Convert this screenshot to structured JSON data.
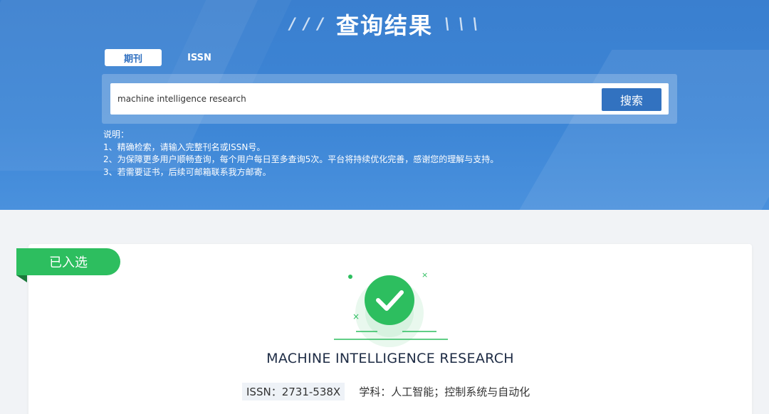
{
  "header": {
    "title": "查询结果",
    "left_decoration": "/ / /",
    "right_decoration": "\\ \\ \\"
  },
  "tabs": [
    {
      "label": "期刊",
      "active": true
    },
    {
      "label": "ISSN",
      "active": false
    }
  ],
  "search": {
    "value": "machine intelligence research",
    "button_label": "搜索"
  },
  "notes": {
    "heading": "说明：",
    "items": [
      "1、精确检索，请输入完整刊名或ISSN号。",
      "2、为保障更多用户顺畅查询，每个用户每日至多查询5次。平台将持续优化完善，感谢您的理解与支持。",
      "3、若需要证书，后续可邮箱联系我方邮寄。"
    ]
  },
  "result": {
    "badge": "已入选",
    "journal_name": "MACHINE INTELLIGENCE RESEARCH",
    "issn": "ISSN：2731-538X",
    "subject": "学科：人工智能；控制系统与自动化"
  },
  "colors": {
    "hero_blue": "#3a7fcf",
    "accent_blue": "#3272c0",
    "success_green": "#2dbe5f"
  },
  "icons": {
    "check": "check-circle-icon"
  }
}
